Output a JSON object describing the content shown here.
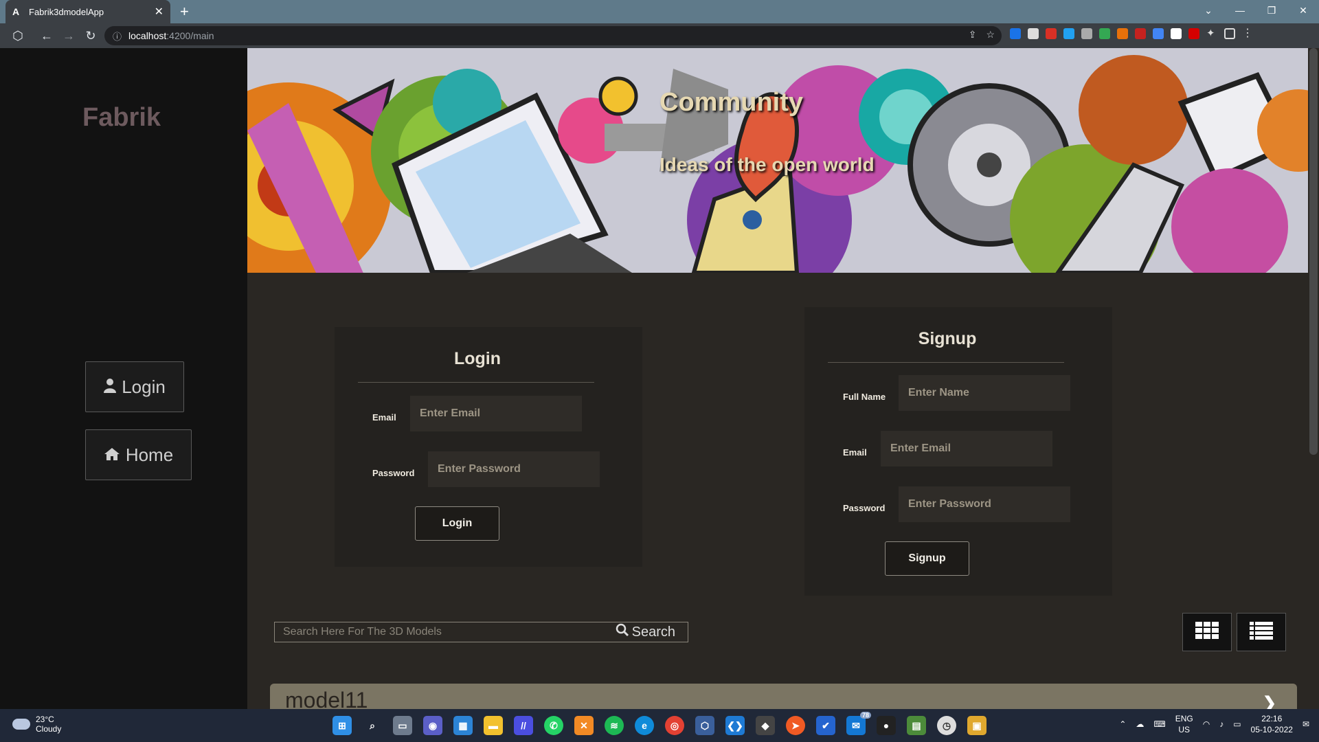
{
  "browser": {
    "tab_title": "Fabrik3dmodelApp",
    "tab_favicon": "A",
    "url_host": "localhost",
    "url_path": ":4200/main"
  },
  "sidebar": {
    "brand": "Fabrik",
    "login_label": "Login",
    "home_label": "Home"
  },
  "banner": {
    "title": "Community",
    "subtitle": "Ideas of the open world"
  },
  "login": {
    "heading": "Login",
    "email_label": "Email",
    "email_placeholder": "Enter Email",
    "password_label": "Password",
    "password_placeholder": "Enter Password",
    "submit_label": "Login"
  },
  "signup": {
    "heading": "Signup",
    "name_label": "Full Name",
    "name_placeholder": "Enter Name",
    "email_label": "Email",
    "email_placeholder": "Enter Email",
    "password_label": "Password",
    "password_placeholder": "Enter Password",
    "submit_label": "Signup"
  },
  "search": {
    "placeholder": "Search Here For The 3D Models",
    "button_label": "Search"
  },
  "models": [
    {
      "name": "model11"
    }
  ],
  "taskbar": {
    "temperature": "23°C",
    "weather": "Cloudy",
    "lang_top": "ENG",
    "lang_bottom": "US",
    "time": "22:16",
    "date": "05-10-2022",
    "badge": "78"
  }
}
